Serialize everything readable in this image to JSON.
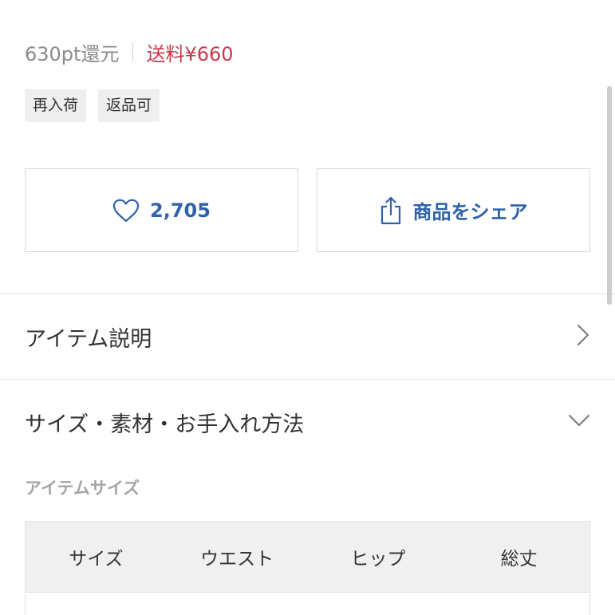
{
  "product": {
    "points_text": "630pt還元",
    "shipping_text": "送料¥660",
    "tags": [
      "再入荷",
      "返品可"
    ]
  },
  "actions": {
    "like_count": "2,705",
    "share_label": "商品をシェア"
  },
  "sections": {
    "description_title": "アイテム説明",
    "size_material_title": "サイズ・素材・お手入れ方法"
  },
  "size_info": {
    "heading": "アイテムサイズ",
    "columns": [
      "サイズ",
      "ウエスト",
      "ヒップ",
      "総丈"
    ]
  },
  "colors": {
    "accent_blue": "#2f62a8",
    "shipping_red": "#c7384a",
    "muted_gray": "#8a8a8a"
  },
  "icons": {
    "like": "heart-icon",
    "share": "share-icon",
    "description": "chevron-right-icon",
    "size_material": "chevron-down-icon"
  }
}
